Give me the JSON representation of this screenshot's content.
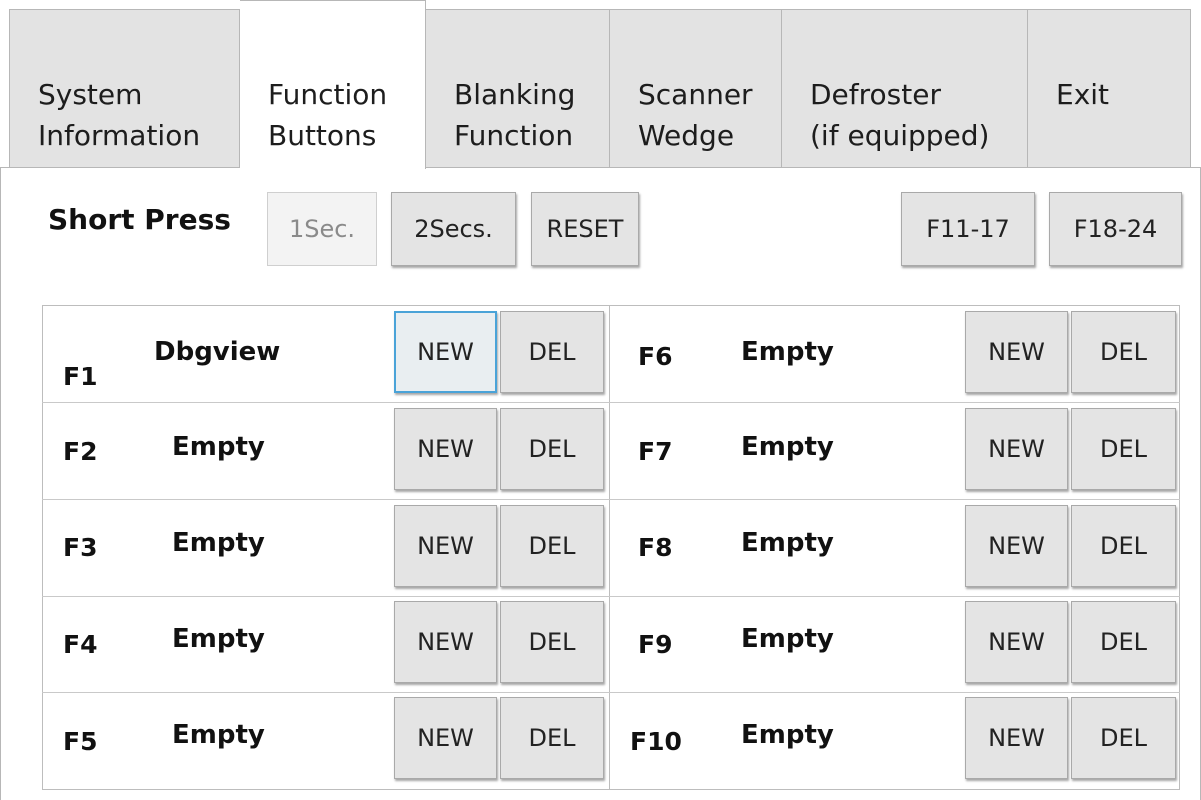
{
  "tabs": [
    {
      "line1": "System",
      "line2": "Information",
      "active": false
    },
    {
      "line1": "Function",
      "line2": "Buttons",
      "active": true
    },
    {
      "line1": "Blanking",
      "line2": "Function",
      "active": false
    },
    {
      "line1": "Scanner",
      "line2": "Wedge",
      "active": false
    },
    {
      "line1": "Defroster",
      "line2": "(if equipped)",
      "active": false
    },
    {
      "line1": "Exit",
      "line2": "",
      "active": false
    }
  ],
  "toolbar": {
    "mode_label": "Short Press",
    "btn_1sec": "1Sec.",
    "btn_2secs": "2Secs.",
    "btn_reset": "RESET",
    "btn_f11_17": "F11-17",
    "btn_f18_24": "F18-24"
  },
  "functions": {
    "left": [
      {
        "key": "F1",
        "name": "Dbgview",
        "new_label": "NEW",
        "del_label": "DEL"
      },
      {
        "key": "F2",
        "name": "Empty",
        "new_label": "NEW",
        "del_label": "DEL"
      },
      {
        "key": "F3",
        "name": "Empty",
        "new_label": "NEW",
        "del_label": "DEL"
      },
      {
        "key": "F4",
        "name": "Empty",
        "new_label": "NEW",
        "del_label": "DEL"
      },
      {
        "key": "F5",
        "name": "Empty",
        "new_label": "NEW",
        "del_label": "DEL"
      }
    ],
    "right": [
      {
        "key": "F6",
        "name": "Empty",
        "new_label": "NEW",
        "del_label": "DEL"
      },
      {
        "key": "F7",
        "name": "Empty",
        "new_label": "NEW",
        "del_label": "DEL"
      },
      {
        "key": "F8",
        "name": "Empty",
        "new_label": "NEW",
        "del_label": "DEL"
      },
      {
        "key": "F9",
        "name": "Empty",
        "new_label": "NEW",
        "del_label": "DEL"
      },
      {
        "key": "F10",
        "name": "Empty",
        "new_label": "NEW",
        "del_label": "DEL"
      }
    ]
  }
}
